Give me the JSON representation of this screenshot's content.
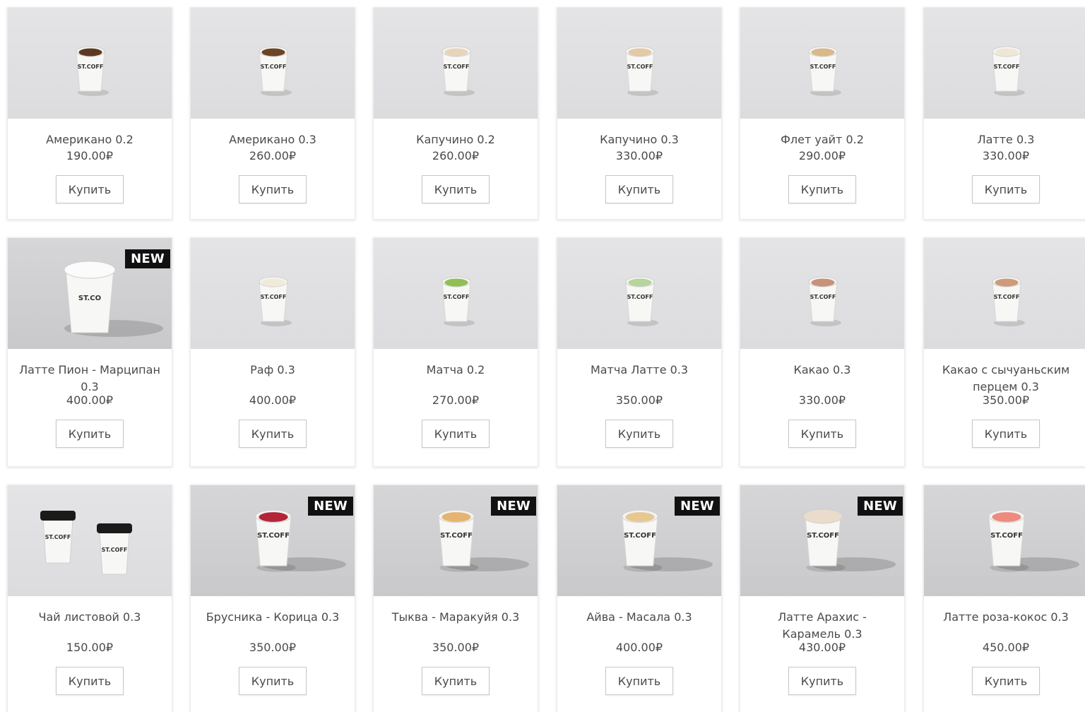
{
  "button_label": "Купить",
  "badge_label": "NEW",
  "brand_on_cup": "ST.COFFEE",
  "products": [
    {
      "title": "Американо 0.2",
      "price": "190.00₽",
      "is_new": false,
      "liquid": "#5a3a22"
    },
    {
      "title": "Американо 0.3",
      "price": "260.00₽",
      "is_new": false,
      "liquid": "#6b4426"
    },
    {
      "title": "Капучино 0.2",
      "price": "260.00₽",
      "is_new": false,
      "liquid": "#e8d4b8"
    },
    {
      "title": "Капучино 0.3",
      "price": "330.00₽",
      "is_new": false,
      "liquid": "#e3c9a5"
    },
    {
      "title": "Флет уайт 0.2",
      "price": "290.00₽",
      "is_new": false,
      "liquid": "#d9b88a"
    },
    {
      "title": "Латте 0.3",
      "price": "330.00₽",
      "is_new": false,
      "liquid": "#efe6d8"
    },
    {
      "title": "Латте Пион - Марципан 0.3",
      "price": "400.00₽",
      "is_new": true,
      "liquid": "#f6f6f6"
    },
    {
      "title": "Раф 0.3",
      "price": "400.00₽",
      "is_new": false,
      "liquid": "#f1ead8"
    },
    {
      "title": "Матча 0.2",
      "price": "270.00₽",
      "is_new": false,
      "liquid": "#8fbf55"
    },
    {
      "title": "Матча Латте 0.3",
      "price": "350.00₽",
      "is_new": false,
      "liquid": "#b5d59c"
    },
    {
      "title": "Какао 0.3",
      "price": "330.00₽",
      "is_new": false,
      "liquid": "#c8917a"
    },
    {
      "title": "Какао с сычуаньским перцем 0.3",
      "price": "350.00₽",
      "is_new": false,
      "liquid": "#cf9a7b"
    },
    {
      "title": "Чай листовой 0.3",
      "price": "150.00₽",
      "is_new": false,
      "liquid": "#222222"
    },
    {
      "title": "Брусника - Корица 0.3",
      "price": "350.00₽",
      "is_new": true,
      "liquid": "#b3263a"
    },
    {
      "title": "Тыква - Маракуйя 0.3",
      "price": "350.00₽",
      "is_new": true,
      "liquid": "#e5b470"
    },
    {
      "title": "Айва - Масала 0.3",
      "price": "400.00₽",
      "is_new": true,
      "liquid": "#e7c792"
    },
    {
      "title": "Латте Арахис - Карамель 0.3",
      "price": "430.00₽",
      "is_new": true,
      "liquid": "#eadccb"
    },
    {
      "title": "Латте роза-кокос 0.3",
      "price": "450.00₽",
      "is_new": false,
      "liquid": "#ee8a7e"
    }
  ]
}
